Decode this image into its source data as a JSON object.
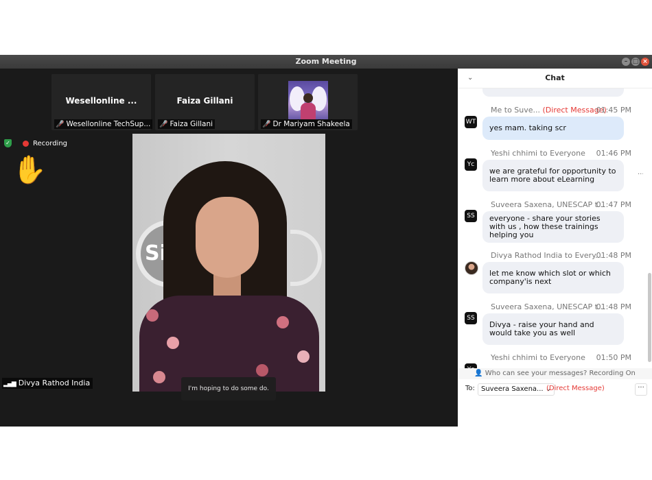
{
  "window": {
    "title": "Zoom Meeting"
  },
  "thumbnails": [
    {
      "display": "Wesellonline ...",
      "label": "Wesellonline TechSup..."
    },
    {
      "display": "Faiza Gillani",
      "label": "Faiza Gillani"
    },
    {
      "display": "",
      "label": "Dr Mariyam Shakeela"
    }
  ],
  "recording": {
    "label": "Recording"
  },
  "main": {
    "participant": "Divya Rathod India",
    "caption": "I'm hoping to do some do."
  },
  "chat": {
    "title": "Chat",
    "messages": [
      {
        "sender": "Me to Suve...",
        "dm": "(Direct Message)",
        "time": "01:45 PM",
        "avatar": "WT",
        "text": "yes mam. taking scr"
      },
      {
        "sender": "Yeshi chhimi to Everyone",
        "dm": "",
        "time": "01:46 PM",
        "avatar": "Yc",
        "text": "we are grateful for opportunity to learn more about eLearning"
      },
      {
        "sender": "Suveera Saxena, UNESCAP t...",
        "dm": "",
        "time": "01:47 PM",
        "avatar": "SS",
        "text": "everyone - share your stories with us , how these trainings helping you"
      },
      {
        "sender": "Divya Rathod India to Every...",
        "dm": "",
        "time": "01:48 PM",
        "avatar": "",
        "text": "let me know which slot or which company'is next"
      },
      {
        "sender": "Suveera Saxena, UNESCAP t...",
        "dm": "",
        "time": "01:48 PM",
        "avatar": "SS",
        "text": "Divya - raise your hand and would take you as well"
      },
      {
        "sender": "Yeshi chhimi to Everyone",
        "dm": "",
        "time": "01:50 PM",
        "avatar": "Yc",
        "text": ""
      }
    ],
    "notice": "Who can see your messages? Recording On",
    "to_label": "To:",
    "to_value": "Suveera Saxena...",
    "to_dm": "(Direct Message)"
  }
}
